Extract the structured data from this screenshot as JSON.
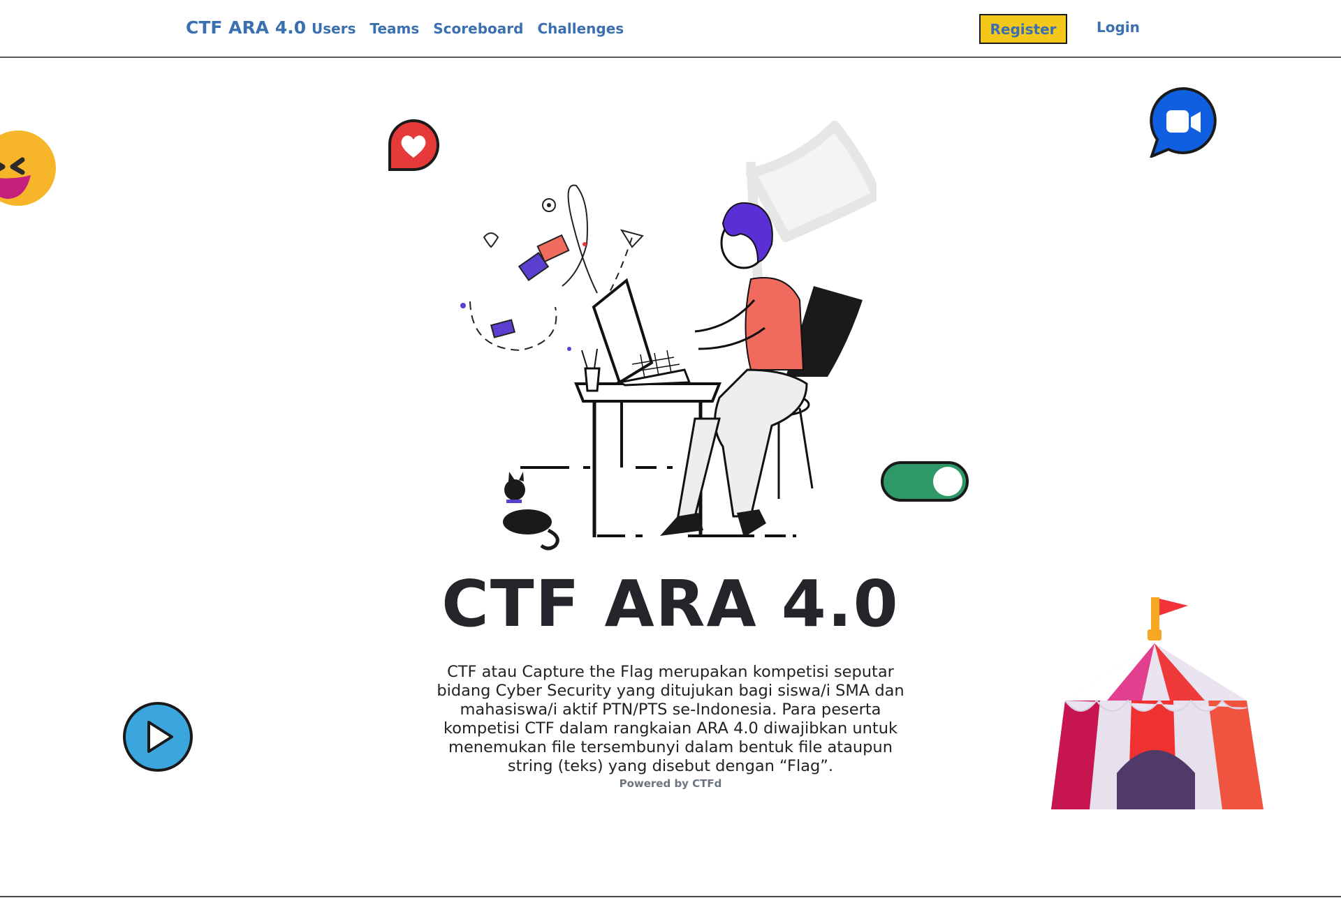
{
  "nav": {
    "brand": "CTF ARA 4.0",
    "links": [
      "Users",
      "Teams",
      "Scoreboard",
      "Challenges"
    ],
    "register": "Register",
    "login": "Login"
  },
  "hero": {
    "title": "CTF ARA 4.0",
    "description": "CTF atau Capture the Flag merupakan kompetisi seputar bidang Cyber Security yang ditujukan bagi siswa/i SMA dan mahasiswa/i aktif PTN/PTS se-Indonesia. Para peserta kompetisi CTF dalam rangkaian ARA 4.0 diwajibkan untuk menemukan file tersembunyi dalam bentuk file ataupun string (teks) yang disebut dengan “Flag”."
  },
  "footer": {
    "powered": "Powered by CTFd"
  },
  "icons": [
    "laughing-emoji-icon",
    "heart-bubble-icon",
    "video-camera-bubble-icon",
    "toggle-switch-icon",
    "play-button-icon",
    "circus-tent-icon"
  ],
  "colors": {
    "link": "#3a6fb0",
    "register_bg": "#f4c81b",
    "title": "#23252a"
  }
}
